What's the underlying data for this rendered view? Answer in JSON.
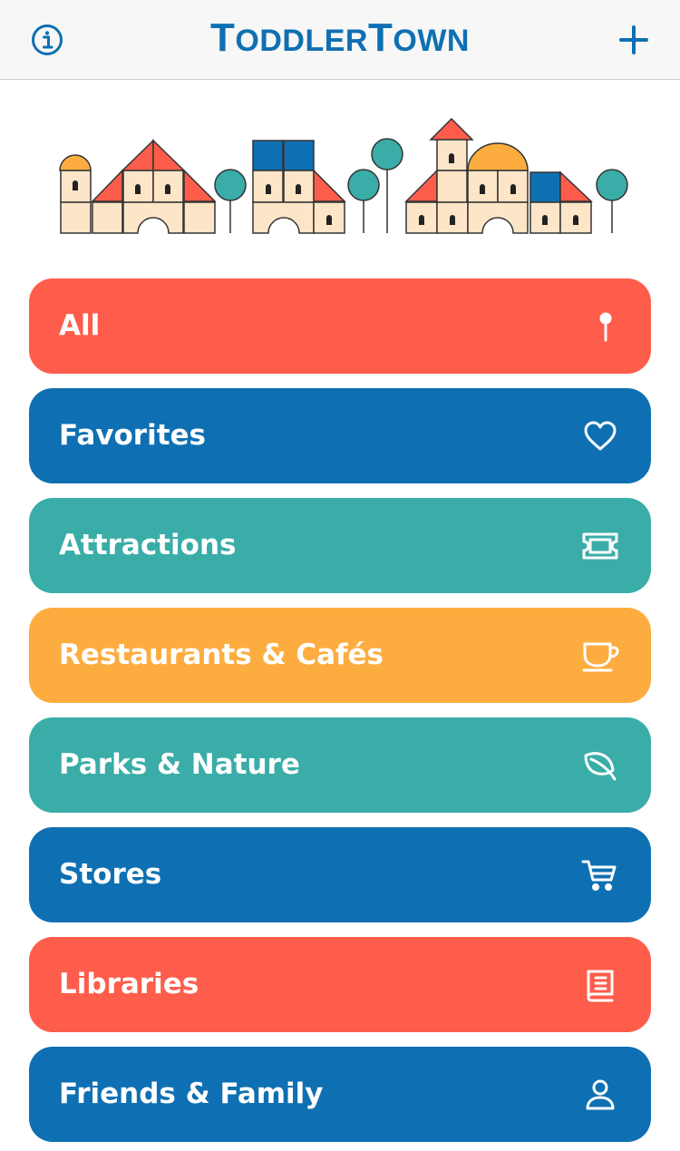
{
  "app": {
    "title_part1_initial": "T",
    "title_part1_rest": "ODDLER",
    "title_part2_initial": "T",
    "title_part2_rest": "OWN"
  },
  "colors": {
    "brand_blue": "#0e70b2",
    "coral": "#fe5d4b",
    "teal": "#3aada8",
    "orange": "#fdad40",
    "cream": "#fde6c8"
  },
  "header": {
    "left_icon": "info-icon",
    "right_icon": "add-icon"
  },
  "categories": [
    {
      "label": "All",
      "icon": "pin-icon",
      "color": "#fe5d4b"
    },
    {
      "label": "Favorites",
      "icon": "heart-icon",
      "color": "#0e70b2"
    },
    {
      "label": "Attractions",
      "icon": "ticket-icon",
      "color": "#3aada8"
    },
    {
      "label": "Restaurants & Cafés",
      "icon": "cup-icon",
      "color": "#fdad40"
    },
    {
      "label": "Parks & Nature",
      "icon": "leaf-icon",
      "color": "#3aada8"
    },
    {
      "label": "Stores",
      "icon": "cart-icon",
      "color": "#0e70b2"
    },
    {
      "label": "Libraries",
      "icon": "book-icon",
      "color": "#fe5d4b"
    },
    {
      "label": "Friends & Family",
      "icon": "person-icon",
      "color": "#0e70b2"
    }
  ]
}
